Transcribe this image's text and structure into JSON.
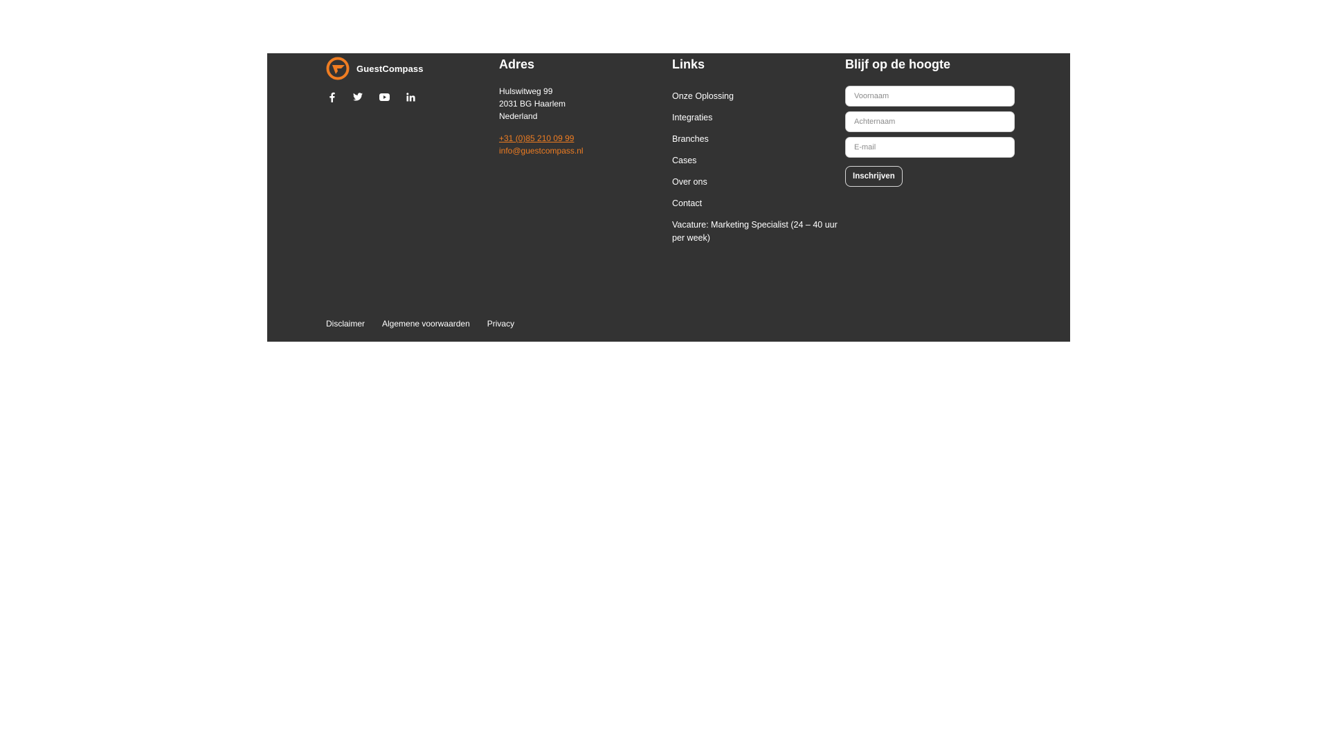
{
  "colors": {
    "footer_background": "#333333",
    "accent": "#ef7d22",
    "text": "#ffffff"
  },
  "brand": {
    "name": "GuestCompass",
    "logo_icon": "guestcompass-logo-icon"
  },
  "socials": [
    {
      "name": "facebook",
      "icon": "facebook-icon"
    },
    {
      "name": "twitter",
      "icon": "twitter-icon"
    },
    {
      "name": "youtube",
      "icon": "youtube-icon"
    },
    {
      "name": "linkedin",
      "icon": "linkedin-icon"
    }
  ],
  "adres": {
    "title": "Adres",
    "street": "Hulswitweg 99",
    "postal_city": "2031 BG Haarlem",
    "country": "Nederland",
    "phone": "+31 (0)85 210 09 99",
    "email": "info@guestcompass.nl"
  },
  "links": {
    "title": "Links",
    "items": [
      "Onze Oplossing",
      "Integraties",
      "Branches",
      "Cases",
      "Over ons",
      "Contact",
      "Vacature: Marketing Specialist (24 – 40 uur per week)"
    ]
  },
  "newsletter": {
    "title": "Blijf op de hoogte",
    "first_name_placeholder": "Voornaam",
    "last_name_placeholder": "Achternaam",
    "email_placeholder": "E-mail",
    "submit_label": "Inschrijven"
  },
  "legal": {
    "items": [
      "Disclaimer",
      "Algemene voorwaarden",
      "Privacy"
    ]
  }
}
